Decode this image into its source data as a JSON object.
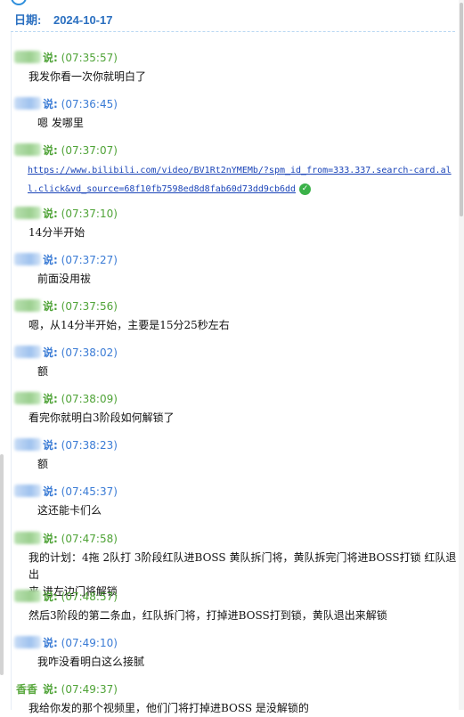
{
  "header": {
    "label": "日期:",
    "date": "2024-10-17"
  },
  "said": "说:",
  "messages": [
    {
      "side": "me",
      "time": "(07:35:57)",
      "text": "我发你看一次你就明白了"
    },
    {
      "side": "peer",
      "time": "(07:36:45)",
      "text": "嗯 发哪里"
    },
    {
      "side": "me",
      "time": "(07:37:07)",
      "text": "",
      "link": "https://www.bilibili.com/video/BV1Rt2nYMEMb/?spm_id_from=333.337.search-card.all.click&vd_source=68f10fb7598ed8d8fab60d73dd9cb6dd",
      "link_icon": "check-circle-icon"
    },
    {
      "side": "me",
      "time": "(07:37:10)",
      "text": "14分半开始"
    },
    {
      "side": "peer",
      "time": "(07:37:27)",
      "text": "前面没用祓"
    },
    {
      "side": "me",
      "time": "(07:37:56)",
      "text": "嗯，从14分半开始，主要是15分25秒左右"
    },
    {
      "side": "peer",
      "time": "(07:38:02)",
      "text": "额"
    },
    {
      "side": "me",
      "time": "(07:38:09)",
      "text": "看完你就明白3阶段如何解锁了"
    },
    {
      "side": "peer",
      "time": "(07:38:23)",
      "text": "额"
    },
    {
      "side": "peer",
      "time": "(07:45:37)",
      "text": "这还能卡们么"
    },
    {
      "side": "me",
      "time": "(07:47:58)",
      "text": "我的计划：4拖 2队打 3阶段红队进BOSS 黄队拆门将，黄队拆完门将进BOSS打锁 红队退出\n来 进左边门将解锁"
    },
    {
      "side": "me",
      "time": "(07:48:57)",
      "text": "然后3阶段的第二条血，红队拆门将，打掉进BOSS打到锁，黄队退出来解锁"
    },
    {
      "side": "peer",
      "time": "(07:49:10)",
      "text": "我咋没看明白这么接腻"
    },
    {
      "side": "me",
      "name": "香香",
      "time": "(07:49:37)",
      "text": "我给你发的那个视频里，他们门将打掉进BOSS 是没解锁的"
    }
  ]
}
